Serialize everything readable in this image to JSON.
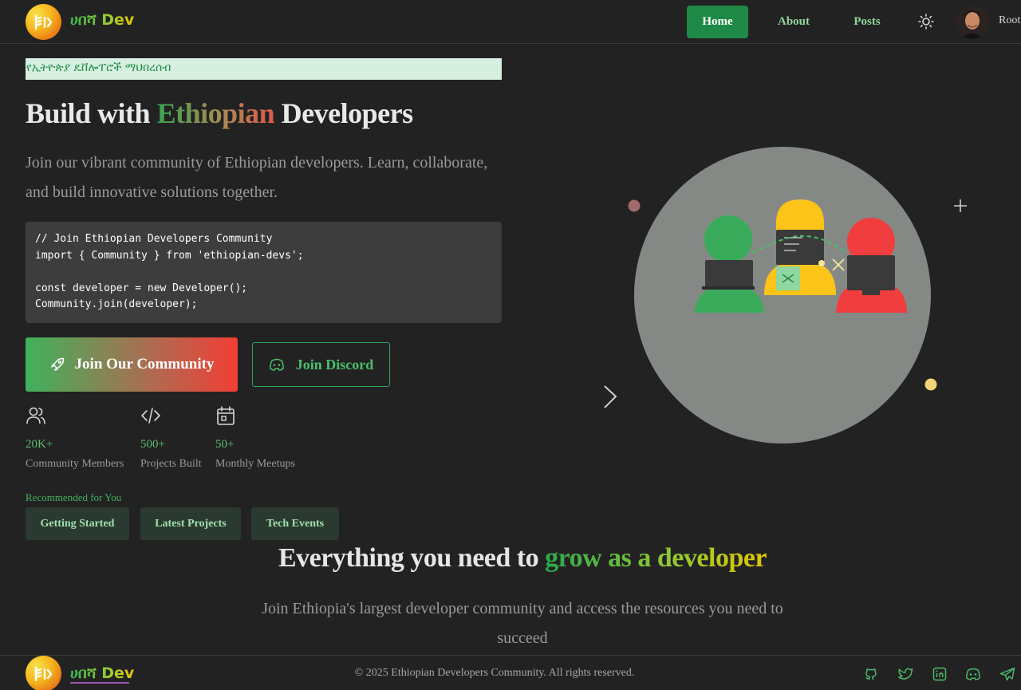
{
  "header": {
    "brand": "ሀበሻ Dev",
    "nav": [
      {
        "label": "Home",
        "active": true
      },
      {
        "label": "About",
        "active": false
      },
      {
        "label": "Posts",
        "active": false
      }
    ],
    "theme_toggle_icon": "sun-icon",
    "user_name": "Root"
  },
  "hero": {
    "tagline": "የኢትዮጵያ ዴቨሎፐሮች ማህበረሰብ",
    "title_prefix": "Build with ",
    "title_highlight": "Ethiopian",
    "title_suffix": " Developers",
    "subtitle": "Join our vibrant community of Ethiopian developers. Learn, collaborate, and build innovative solutions together.",
    "code_lines": [
      "// Join Ethiopian Developers Community",
      "import { Community } from 'ethiopian-devs';",
      "",
      "const developer = new Developer();",
      "Community.join(developer);"
    ],
    "primary_button": "Join Our Community",
    "secondary_button": "Join Discord",
    "stats": [
      {
        "icon": "users-icon",
        "value": "20K+",
        "label": "Community Members"
      },
      {
        "icon": "code-icon",
        "value": "500+",
        "label": "Projects Built"
      },
      {
        "icon": "calendar-icon",
        "value": "50+",
        "label": "Monthly Meetups"
      }
    ],
    "recommended_label": "Recommended for You",
    "recommended": [
      "Getting Started",
      "Latest Projects",
      "Tech Events"
    ]
  },
  "features": {
    "title_prefix": "Everything you need to ",
    "title_highlight": "grow as a developer",
    "subtitle": "Join Ethiopia's largest developer community and access the resources you need to succeed"
  },
  "footer": {
    "brand": "ሀበሻ Dev",
    "copyright": "© 2025 Ethiopian Developers Community. All rights reserved.",
    "social": [
      "github-icon",
      "twitter-icon",
      "linkedin-icon",
      "discord-icon",
      "telegram-icon"
    ]
  },
  "colors": {
    "background": "#222222",
    "accent_green": "#1f8a47",
    "ethiopia_green": "#3aab5a",
    "ethiopia_yellow": "#fcc419",
    "ethiopia_red": "#f03e3e"
  }
}
